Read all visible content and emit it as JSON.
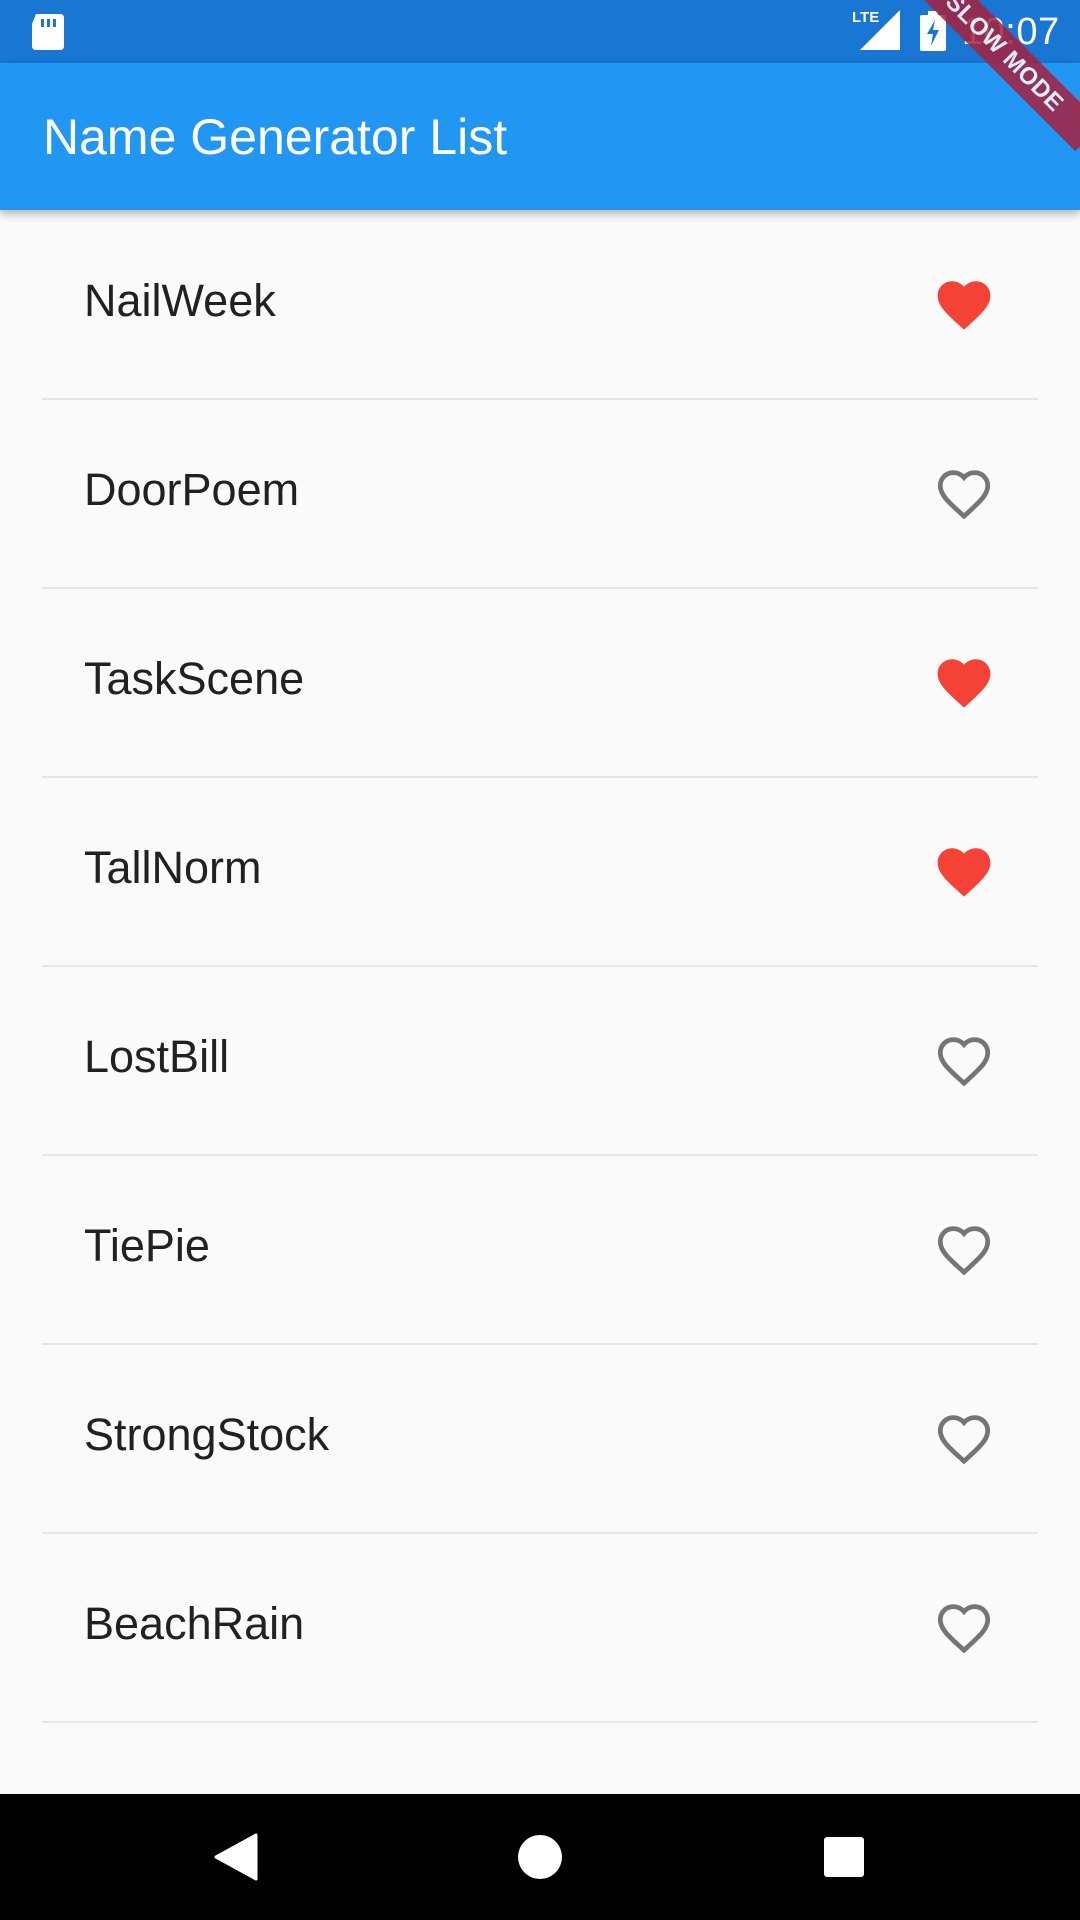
{
  "status_bar": {
    "time": "10:07",
    "network_label": "LTE",
    "icons": [
      "sd-card-icon",
      "lte-signal-icon",
      "battery-charging-icon"
    ],
    "color": "#1976d2"
  },
  "app_bar": {
    "title": "Name Generator List",
    "color": "#2196f3"
  },
  "debug_banner": {
    "label": "SLOW MODE",
    "color": "#a6213d"
  },
  "list": {
    "items": [
      {
        "label": "NailWeek",
        "favorited": true
      },
      {
        "label": "DoorPoem",
        "favorited": false
      },
      {
        "label": "TaskScene",
        "favorited": true
      },
      {
        "label": "TallNorm",
        "favorited": true
      },
      {
        "label": "LostBill",
        "favorited": false
      },
      {
        "label": "TiePie",
        "favorited": false
      },
      {
        "label": "StrongStock",
        "favorited": false
      },
      {
        "label": "BeachRain",
        "favorited": false
      }
    ],
    "favorite_color": "#f44336",
    "unfavorite_color": "#757575",
    "icons": {
      "favorited": "heart-filled-icon",
      "unfavorited": "heart-outline-icon"
    }
  },
  "nav_bar": {
    "icons": [
      "back-triangle-icon",
      "home-circle-icon",
      "recents-square-icon"
    ]
  }
}
